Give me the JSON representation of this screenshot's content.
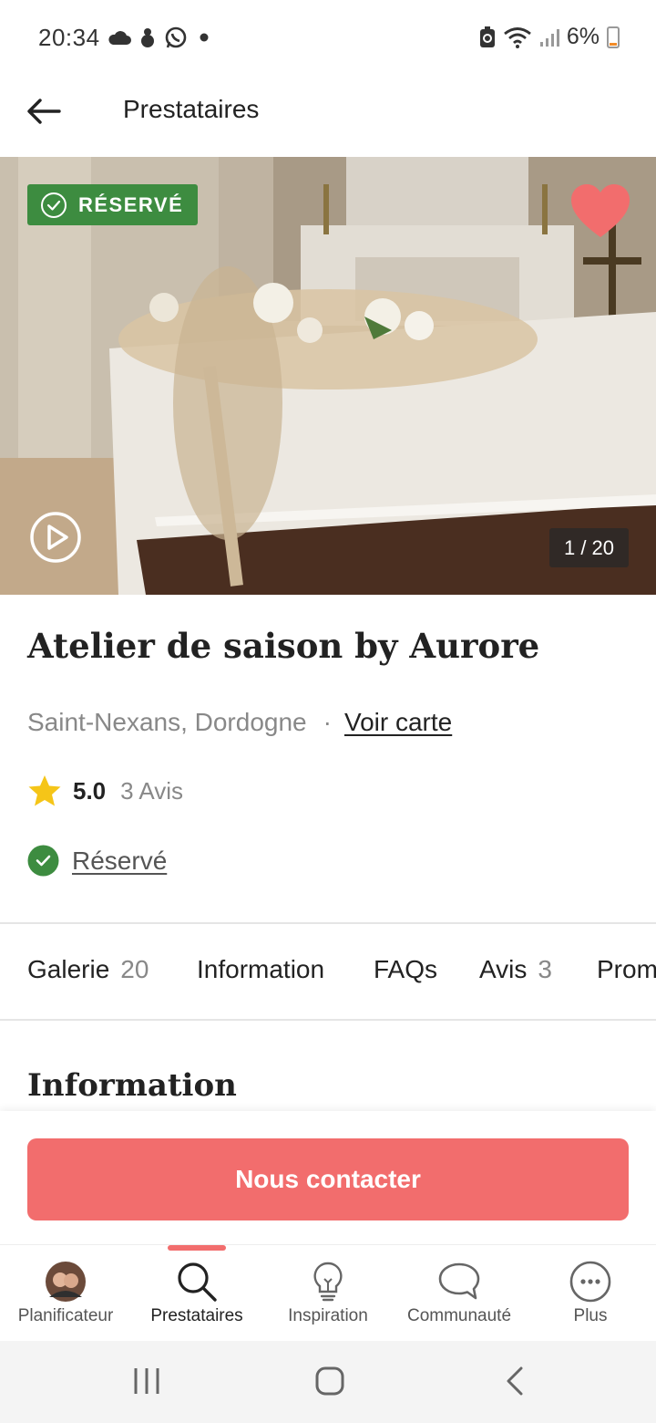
{
  "status_bar": {
    "time": "20:34",
    "battery": "6%",
    "left_icons": [
      "cloud-icon",
      "snowman-icon",
      "whatsapp-icon",
      "dot-icon"
    ],
    "right_icons": [
      "battery-saver-icon",
      "wifi-icon",
      "signal-icon",
      "battery-icon"
    ]
  },
  "header": {
    "back_icon": "arrow-left-icon",
    "title": "Prestataires"
  },
  "gallery": {
    "badge_label": "RÉSERVÉ",
    "counter": "1 / 20",
    "favorite_icon": "heart-icon",
    "favorite_color": "#f26d6d",
    "play_icon": "play-icon"
  },
  "vendor": {
    "name": "Atelier de saison by Aurore",
    "location": "Saint-Nexans, Dordogne",
    "separator": "·",
    "map_link": "Voir carte",
    "rating": "5.0",
    "reviews": "3 Avis",
    "reserved_label": "Réservé"
  },
  "tabs": [
    {
      "label": "Galerie",
      "count": "20"
    },
    {
      "label": "Information",
      "count": ""
    },
    {
      "label": "FAQs",
      "count": ""
    },
    {
      "label": "Avis",
      "count": "3"
    },
    {
      "label": "Prom",
      "count": ""
    }
  ],
  "section": {
    "title": "Information"
  },
  "contact": {
    "label": "Nous contacter",
    "color": "#f26d6d"
  },
  "bottom_nav": [
    {
      "label": "Planificateur",
      "icon": "avatar-icon",
      "active": false
    },
    {
      "label": "Prestataires",
      "icon": "search-icon",
      "active": true
    },
    {
      "label": "Inspiration",
      "icon": "lightbulb-icon",
      "active": false
    },
    {
      "label": "Communauté",
      "icon": "chat-bubble-icon",
      "active": false
    },
    {
      "label": "Plus",
      "icon": "more-icon",
      "active": false
    }
  ],
  "colors": {
    "accent": "#f26d6d",
    "reserved_green": "#3d8c40",
    "star": "#f5c518"
  }
}
